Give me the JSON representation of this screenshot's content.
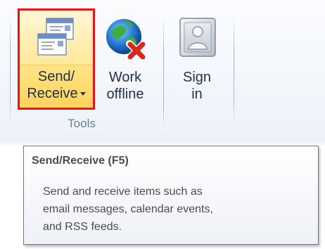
{
  "ribbon": {
    "group_label": "Tools",
    "buttons": [
      {
        "label_line1": "Send/",
        "label_line2": "Receive",
        "icon": "send-receive-icon",
        "has_dropdown": true,
        "highlighted": true
      },
      {
        "label_line1": "Work",
        "label_line2": "offline",
        "icon": "globe-offline-icon"
      },
      {
        "label_line1": "Sign",
        "label_line2": "in",
        "icon": "person-signin-icon"
      }
    ],
    "highlight_color": "#e8141a"
  },
  "tooltip": {
    "title": "Send/Receive (F5)",
    "body_line1": "Send and receive items such as",
    "body_line2": "email messages, calendar events,",
    "body_line3": "and RSS feeds."
  }
}
